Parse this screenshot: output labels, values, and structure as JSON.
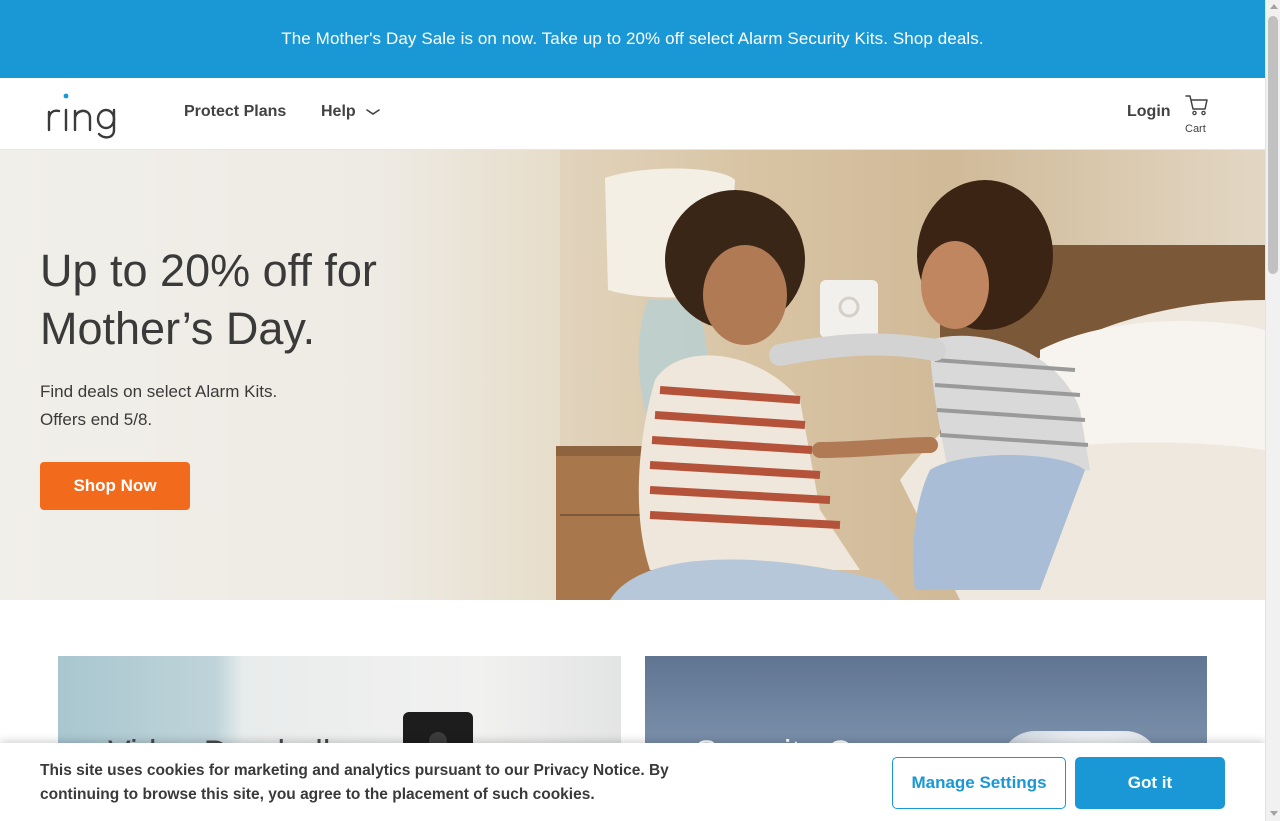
{
  "promo": {
    "text": "The Mother's Day Sale is on now. Take up to 20% off select Alarm Security Kits. Shop deals."
  },
  "header": {
    "logo_text": "ring",
    "nav": [
      {
        "label": "Protect Plans"
      },
      {
        "label": "Help"
      }
    ],
    "login_label": "Login",
    "cart_label": "Cart"
  },
  "hero": {
    "title_line1": "Up to 20% off for",
    "title_line2": "Mother’s Day.",
    "subtitle_line1": "Find deals on select Alarm Kits.",
    "subtitle_line2": "Offers end 5/8.",
    "cta_label": "Shop Now"
  },
  "cards": [
    {
      "title": "Video Doorbells"
    },
    {
      "title": "Security Cameras"
    }
  ],
  "cookie_banner": {
    "message": "This site uses cookies for marketing and analytics pursuant to our Privacy Notice. By continuing to browse this site, you agree to the placement of such cookies.",
    "manage_label": "Manage Settings",
    "accept_label": "Got it"
  },
  "colors": {
    "brand_blue": "#1998d5",
    "cta_orange": "#f26a1b",
    "text_dark": "#3a3a3a"
  },
  "icons": {
    "cart": "shopping-cart-icon",
    "help_dropdown": "chevron-down-icon"
  }
}
